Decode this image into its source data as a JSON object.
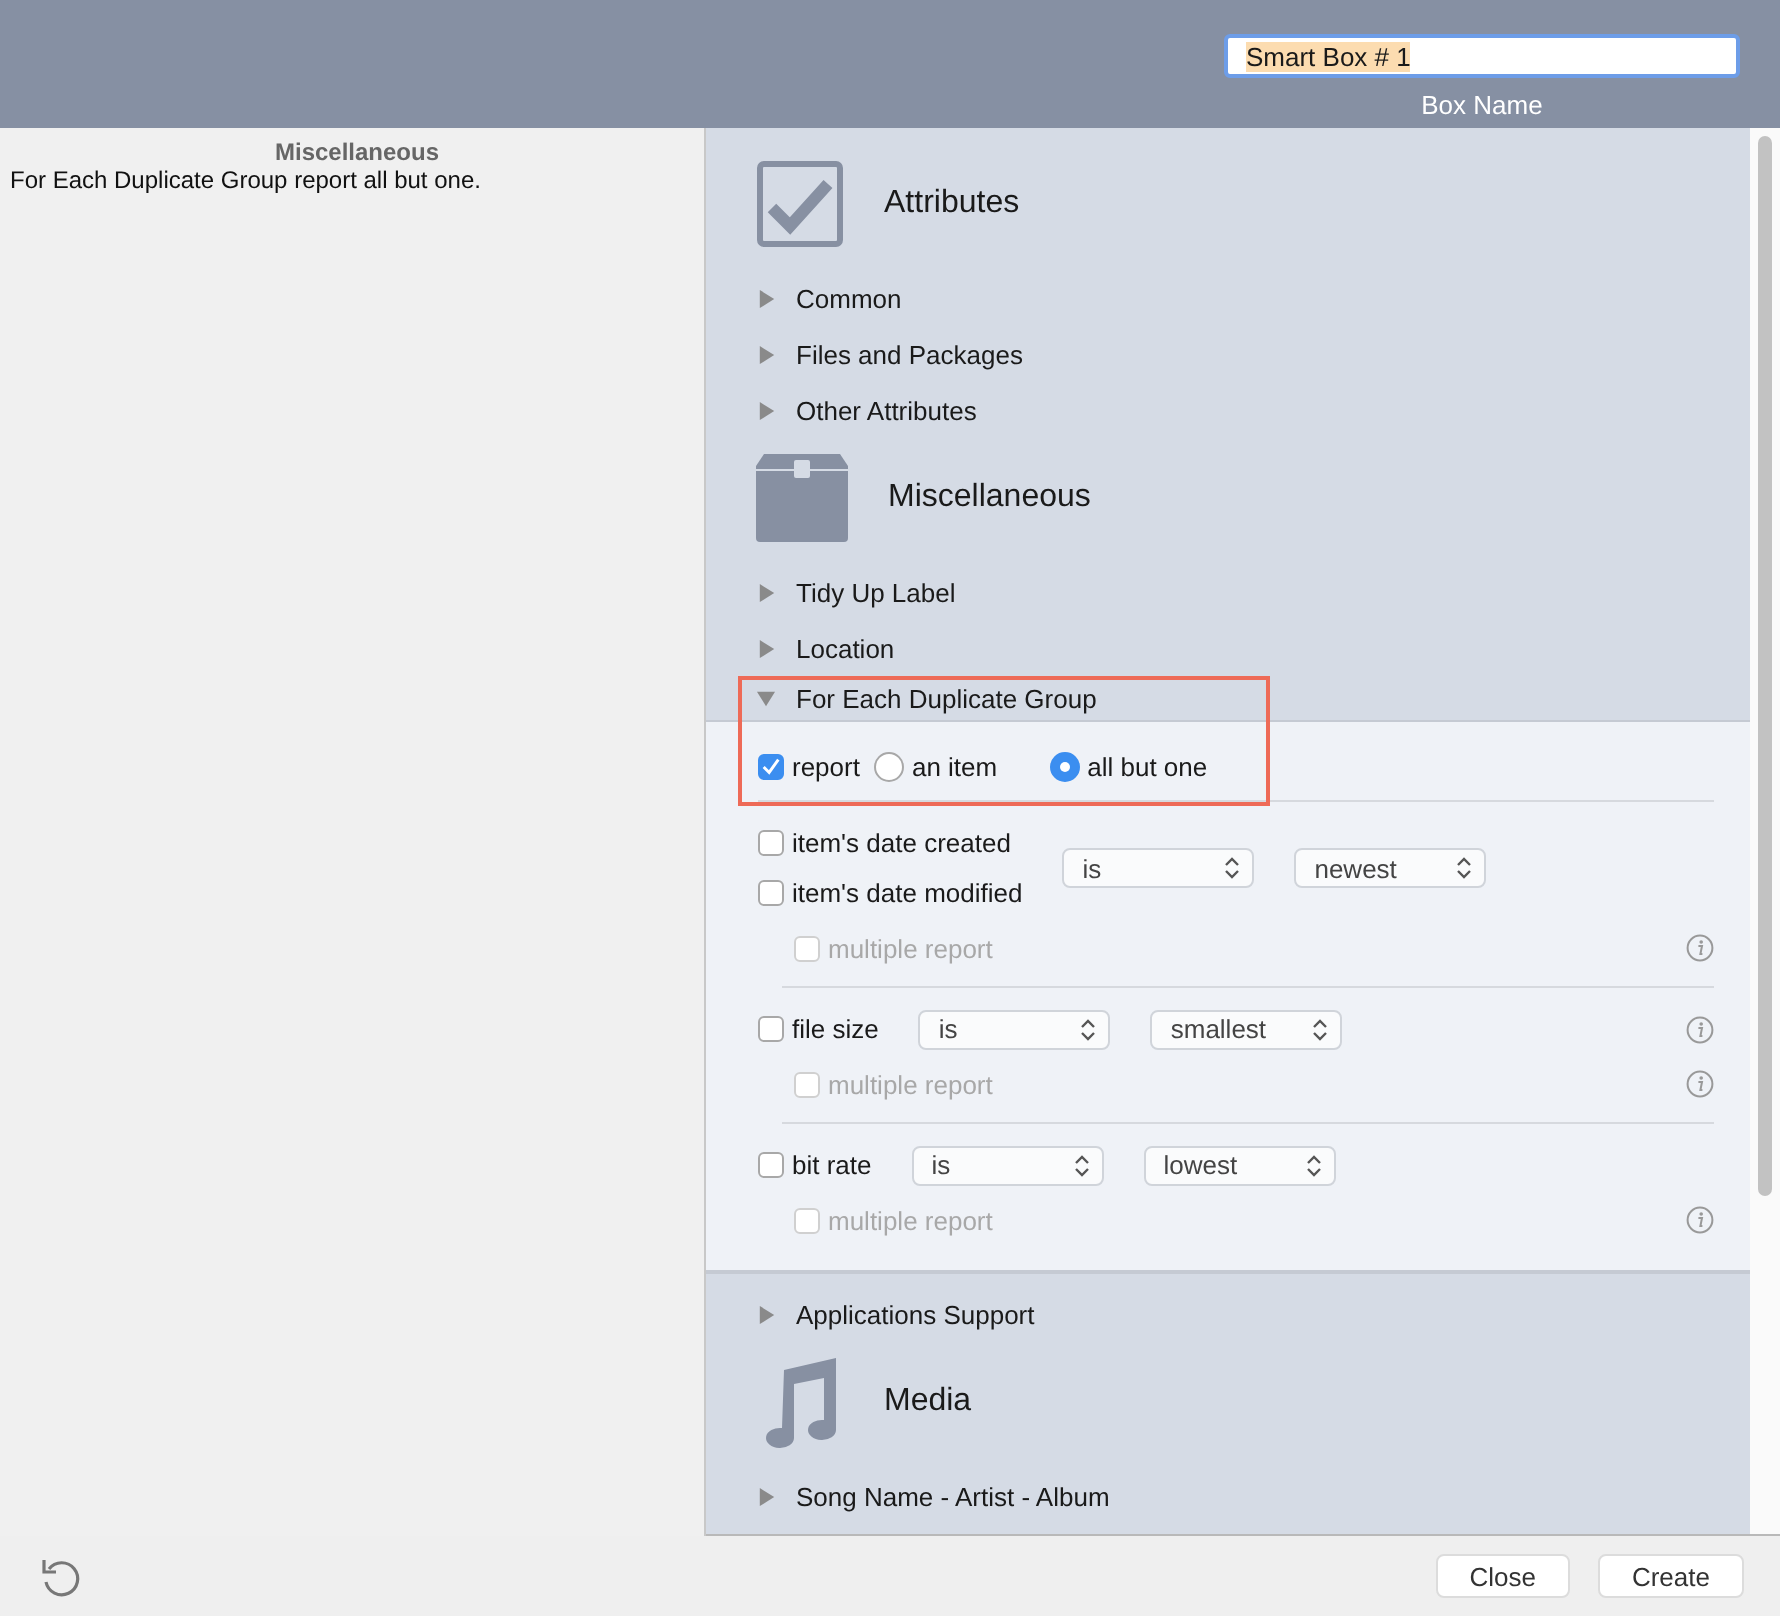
{
  "box_name": {
    "value": "Smart Box # 1",
    "label": "Box Name"
  },
  "summary": {
    "title": "Miscellaneous",
    "text": "For Each Duplicate Group report all but one."
  },
  "sections": [
    {
      "title": "Attributes",
      "kind": "checkbox",
      "items": [
        {
          "label": "Common",
          "expanded": false
        },
        {
          "label": "Files and Packages",
          "expanded": false
        },
        {
          "label": "Other Attributes",
          "expanded": false
        }
      ]
    },
    {
      "title": "Miscellaneous",
      "kind": "box",
      "items": [
        {
          "label": "Tidy Up Label",
          "expanded": false
        },
        {
          "label": "Location",
          "expanded": false
        },
        {
          "label": "For Each Duplicate Group",
          "expanded": true,
          "highlighted": true,
          "panel": {
            "report": {
              "label": "report",
              "checked": true
            },
            "options": [
              {
                "label": "an item",
                "selected": false
              },
              {
                "label": "all but one",
                "selected": true
              }
            ],
            "groups": [
              {
                "criteria": [
                  {
                    "label": "item's date created",
                    "checked": false
                  },
                  {
                    "label": "item's date modified",
                    "checked": false
                  }
                ],
                "operator": "is",
                "value": "newest",
                "criteria_info": false,
                "multiple": {
                  "label": "multiple report",
                  "checked": false,
                  "disabled": true
                }
              },
              {
                "criteria": [
                  {
                    "label": "file size",
                    "checked": false
                  }
                ],
                "operator": "is",
                "value": "smallest",
                "criteria_info": true,
                "multiple": {
                  "label": "multiple report",
                  "checked": false,
                  "disabled": true
                }
              },
              {
                "criteria": [
                  {
                    "label": "bit rate",
                    "checked": false
                  }
                ],
                "operator": "is",
                "value": "lowest",
                "criteria_info": false,
                "multiple": {
                  "label": "multiple report",
                  "checked": false,
                  "disabled": true
                }
              }
            ]
          }
        },
        {
          "label": "Applications Support",
          "expanded": false
        }
      ]
    },
    {
      "title": "Media",
      "kind": "note",
      "items": [
        {
          "label": "Song Name - Artist - Album",
          "expanded": false
        }
      ]
    }
  ],
  "buttons": [
    "Close",
    "Create"
  ]
}
